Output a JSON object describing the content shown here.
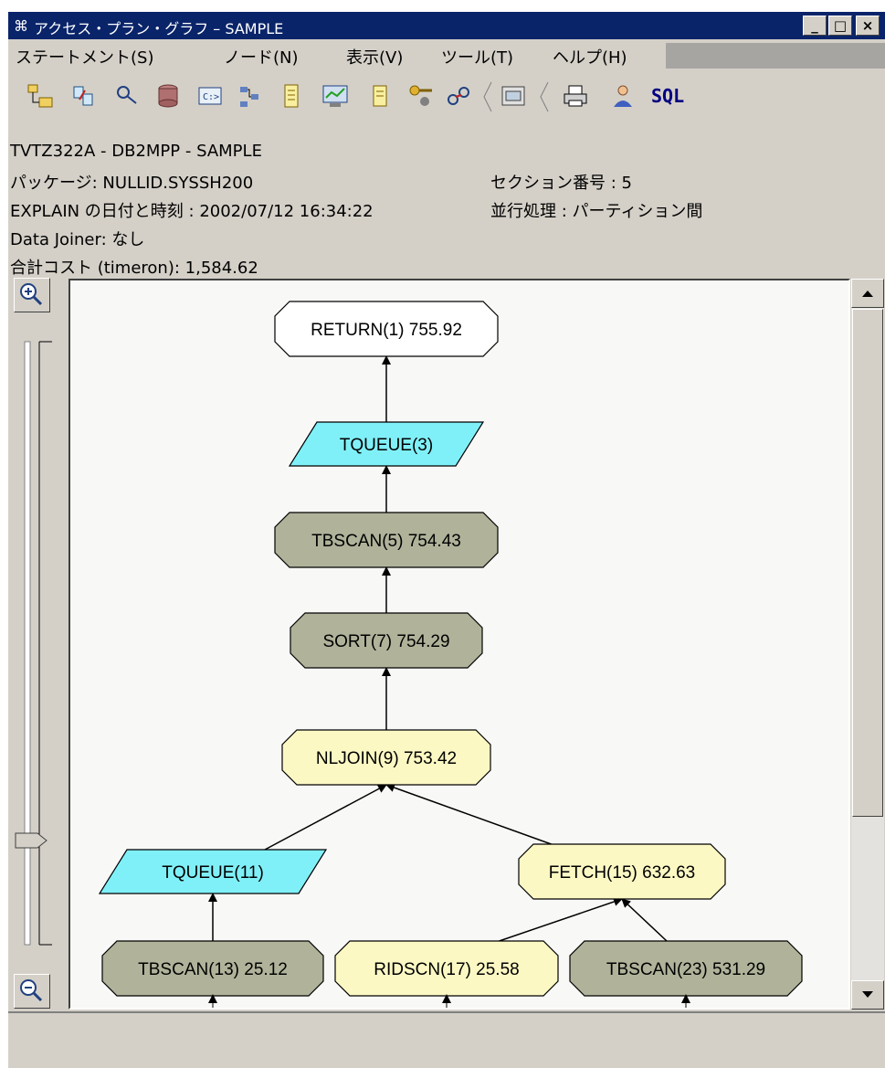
{
  "window": {
    "title": "アクセス・プラン・グラフ – SAMPLE"
  },
  "titlebar_buttons": {
    "minimize": "_",
    "maximize": "□",
    "close": "×"
  },
  "menu": [
    {
      "label": "ステートメント(S)"
    },
    {
      "label": "ノード(N)"
    },
    {
      "label": "表示(V)"
    },
    {
      "label": "ツール(T)"
    },
    {
      "label": "ヘルプ(H)"
    }
  ],
  "toolbar": {
    "icons": [
      "tree-view-icon",
      "statement-icon",
      "search-icon",
      "database-icon",
      "command-icon",
      "hierarchy-icon",
      "list-icon",
      "monitor-icon",
      "notes-icon",
      "key-user-icon",
      "link-icon",
      "settings-panel-icon",
      "print-icon",
      "user-icon",
      "sql-icon"
    ],
    "sql_label": "SQL"
  },
  "info": {
    "system": "TVTZ322A - DB2MPP - SAMPLE",
    "package": "パッケージ: NULLID.SYSSH200",
    "section": "セクション番号 : 5",
    "explain_time": "EXPLAIN の日付と時刻 : 2002/07/12 16:34:22",
    "parallel": "並行処理 : パーティション間",
    "data_joiner": "Data Joiner: なし",
    "total_cost": "合計コスト (timeron): 1,584.62"
  },
  "colors": {
    "return": "#ffffff",
    "queue": "#80f0f8",
    "scan": "#b0b39a",
    "join": "#fbf8c4"
  },
  "graph": {
    "nodes": [
      {
        "id": "return1",
        "label": "RETURN(1) 755.92",
        "kind": "return"
      },
      {
        "id": "tqueue3",
        "label": "TQUEUE(3)",
        "kind": "queue"
      },
      {
        "id": "tbscan5",
        "label": "TBSCAN(5) 754.43",
        "kind": "scan"
      },
      {
        "id": "sort7",
        "label": "SORT(7) 754.29",
        "kind": "scan"
      },
      {
        "id": "nljoin9",
        "label": "NLJOIN(9) 753.42",
        "kind": "join"
      },
      {
        "id": "tqueue11",
        "label": "TQUEUE(11)",
        "kind": "queue"
      },
      {
        "id": "fetch15",
        "label": "FETCH(15) 632.63",
        "kind": "join"
      },
      {
        "id": "tbscan13",
        "label": "TBSCAN(13) 25.12",
        "kind": "scan"
      },
      {
        "id": "ridscn17",
        "label": "RIDSCN(17) 25.58",
        "kind": "join"
      },
      {
        "id": "tbscan23",
        "label": "TBSCAN(23) 531.29",
        "kind": "scan"
      }
    ],
    "edges": [
      [
        "tqueue3",
        "return1"
      ],
      [
        "tbscan5",
        "tqueue3"
      ],
      [
        "sort7",
        "tbscan5"
      ],
      [
        "nljoin9",
        "sort7"
      ],
      [
        "tqueue11",
        "nljoin9"
      ],
      [
        "fetch15",
        "nljoin9"
      ],
      [
        "tbscan13",
        "tqueue11"
      ],
      [
        "ridscn17",
        "fetch15"
      ],
      [
        "tbscan23",
        "fetch15"
      ]
    ]
  }
}
